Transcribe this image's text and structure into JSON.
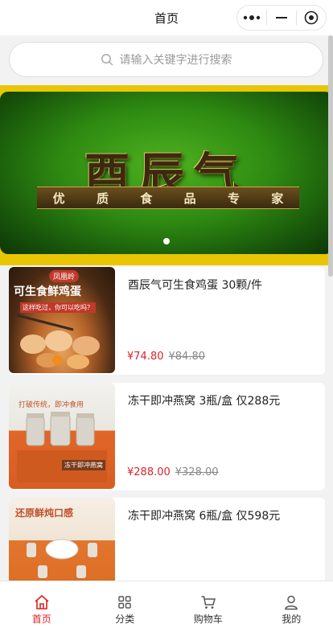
{
  "nav": {
    "title": "首页"
  },
  "search": {
    "placeholder": "请输入关键字进行搜索"
  },
  "banner": {
    "logo_text": "酉辰气",
    "slogan_chars": [
      "优",
      "质",
      "食",
      "品",
      "专",
      "家"
    ]
  },
  "products": [
    {
      "title": "酉辰气可生食鸡蛋 30颗/件",
      "price": "¥74.80",
      "original_price": "¥84.80",
      "thumb_text": [
        "凤凰岭",
        "可生食鲜鸡蛋",
        "这样吃过，你可以吃吗？"
      ]
    },
    {
      "title": "冻干即冲燕窝 3瓶/盒 仅288元",
      "price": "¥288.00",
      "original_price": "¥328.00",
      "thumb_text": [
        "打破传统，即冲食用",
        "冻干即冲燕窝"
      ]
    },
    {
      "title": "冻干即冲燕窝 6瓶/盒 仅598元",
      "price": "",
      "original_price": "",
      "thumb_text": [
        "还原鲜炖口感"
      ]
    }
  ],
  "tabbar": [
    {
      "label": "首页",
      "icon": "home-icon",
      "active": true
    },
    {
      "label": "分类",
      "icon": "category-icon",
      "active": false
    },
    {
      "label": "购物车",
      "icon": "cart-icon",
      "active": false
    },
    {
      "label": "我的",
      "icon": "user-icon",
      "active": false
    }
  ],
  "colors": {
    "accent": "#e02020",
    "price": "#d9232f",
    "band": "#e9c603"
  }
}
